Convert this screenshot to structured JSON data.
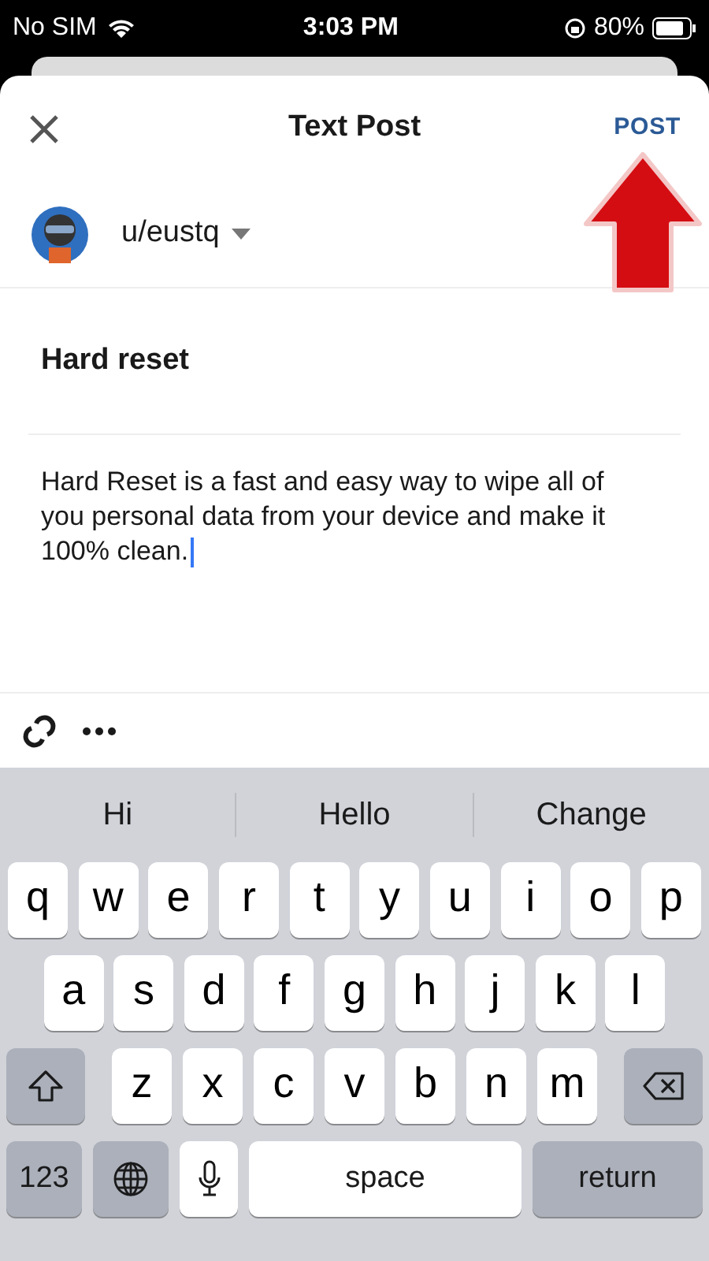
{
  "status_bar": {
    "carrier": "No SIM",
    "time": "3:03 PM",
    "battery": "80%"
  },
  "header": {
    "title": "Text Post",
    "action": "POST"
  },
  "author": {
    "username": "u/eustq"
  },
  "post": {
    "title": "Hard reset",
    "body": "Hard Reset is a fast and easy way to wipe all of you personal data from your device and make it 100% clean."
  },
  "keyboard": {
    "suggestions": [
      "Hi",
      "Hello",
      "Change"
    ],
    "rows": [
      [
        "q",
        "w",
        "e",
        "r",
        "t",
        "y",
        "u",
        "i",
        "o",
        "p"
      ],
      [
        "a",
        "s",
        "d",
        "f",
        "g",
        "h",
        "j",
        "k",
        "l"
      ],
      [
        "z",
        "x",
        "c",
        "v",
        "b",
        "n",
        "m"
      ]
    ],
    "numbers_key": "123",
    "space_key": "space",
    "return_key": "return"
  }
}
